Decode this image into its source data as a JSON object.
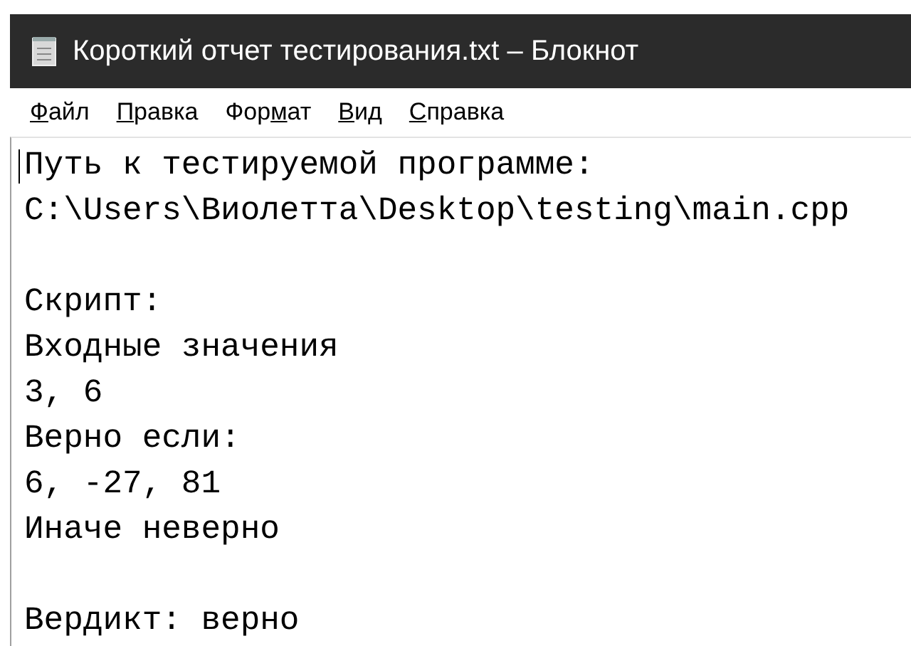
{
  "window": {
    "title": "Короткий отчет тестирования.txt – Блокнот"
  },
  "menu": [
    {
      "key": "Ф",
      "after": "айл"
    },
    {
      "key": "П",
      "after": "равка"
    },
    {
      "before": "Фор",
      "key": "м",
      "after": "ат"
    },
    {
      "key": "В",
      "after": "ид"
    },
    {
      "key": "С",
      "after": "правка"
    }
  ],
  "document": {
    "blocks": [
      [
        "Путь к тестируемой программе:",
        "C:\\Users\\Виолетта\\Desktop\\testing\\main.cpp"
      ],
      [
        "Скрипт:",
        "Входные значения",
        "3, 6",
        "Верно если:",
        "6, -27, 81",
        "Иначе неверно"
      ],
      [
        "Вердикт: верно"
      ]
    ]
  }
}
